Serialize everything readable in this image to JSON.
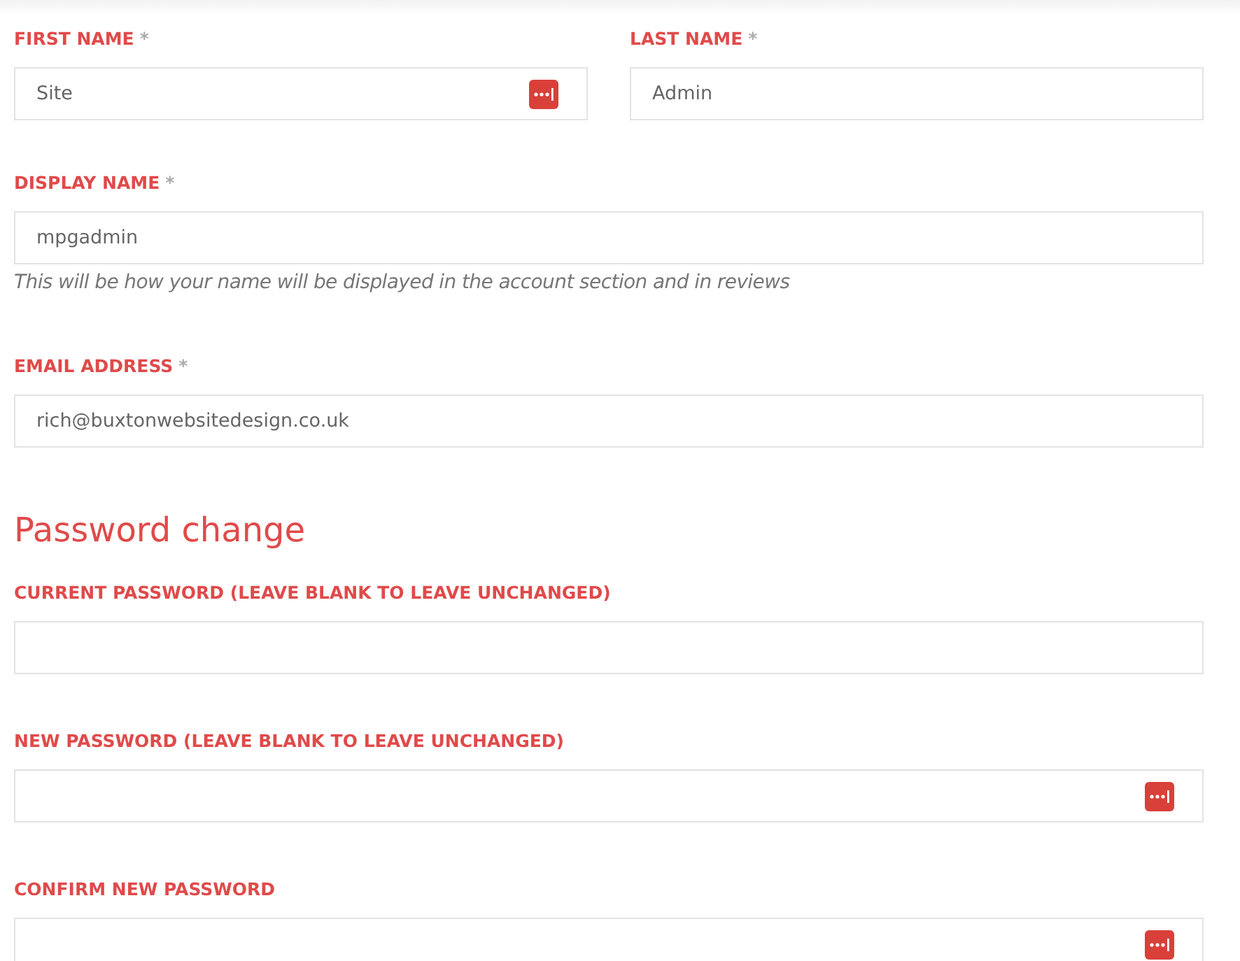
{
  "name_row": [
    {
      "label": "FIRST NAME",
      "required_mark": "*",
      "value": "Site",
      "password_manager": true
    },
    {
      "label": "LAST NAME",
      "required_mark": "*",
      "value": "Admin",
      "password_manager": false
    }
  ],
  "account_fields": [
    {
      "label": "DISPLAY NAME",
      "required_mark": "*",
      "value": "mpgadmin",
      "hint": "This will be how your name will be displayed in the account section and in reviews",
      "password_manager": false
    },
    {
      "label": "EMAIL ADDRESS",
      "required_mark": "*",
      "value": "rich@buxtonwebsitedesign.co.uk",
      "password_manager": false
    }
  ],
  "password_section": {
    "heading": "Password change",
    "fields": [
      {
        "label": "CURRENT PASSWORD (LEAVE BLANK TO LEAVE UNCHANGED)",
        "password_manager": false
      },
      {
        "label": "NEW PASSWORD (LEAVE BLANK TO LEAVE UNCHANGED)",
        "password_manager": true
      },
      {
        "label": "CONFIRM NEW PASSWORD",
        "password_manager": true
      }
    ]
  }
}
